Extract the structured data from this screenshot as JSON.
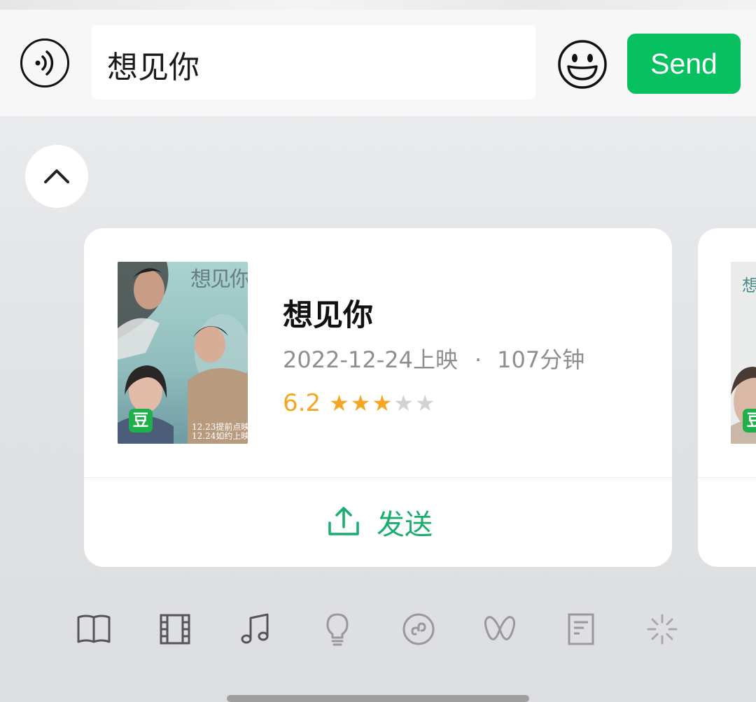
{
  "input_bar": {
    "voice_icon": "voice-input-icon",
    "text_value": "想见你",
    "emoji_icon": "emoji-icon",
    "send_label": "Send",
    "accent_color": "#07c160"
  },
  "panel": {
    "collapse_icon": "chevron-up-icon"
  },
  "movie_card": {
    "poster": {
      "title_art": "想见你",
      "date_line_1": "12.23提前点映",
      "date_line_2": "12.24如约上映",
      "badge": "豆"
    },
    "title": "想见你",
    "release": "2022-12-24上映",
    "separator": "·",
    "duration": "107分钟",
    "rating": "6.2",
    "stars_filled": 3,
    "stars_total": 5,
    "send_icon": "share-upload-icon",
    "send_label": "发送"
  },
  "next_card": {
    "poster_title_art": "想你",
    "badge": "豆"
  },
  "bottom_toolbar": [
    {
      "icon": "book-icon"
    },
    {
      "icon": "film-icon"
    },
    {
      "icon": "music-icon"
    },
    {
      "icon": "lightbulb-icon"
    },
    {
      "icon": "mini-program-icon"
    },
    {
      "icon": "channels-icon"
    },
    {
      "icon": "article-icon"
    },
    {
      "icon": "loading-spinner-icon"
    }
  ]
}
